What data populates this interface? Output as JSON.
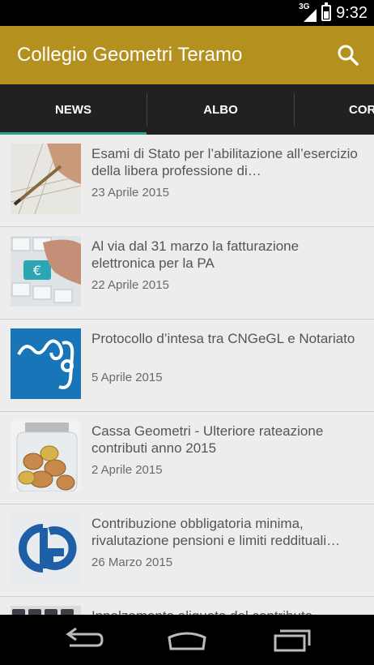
{
  "status_bar": {
    "network": "3G",
    "time": "9:32"
  },
  "action_bar": {
    "title": "Collegio Geometri Teramo",
    "search_icon": "search-icon"
  },
  "tabs": [
    {
      "label": "NEWS",
      "selected": true
    },
    {
      "label": "ALBO",
      "selected": false
    },
    {
      "label": "COR",
      "selected": false
    }
  ],
  "colors": {
    "action_bar": "#b4901e",
    "tab_bg": "#212121",
    "tab_indicator": "#2a9d94",
    "list_bg": "#ededed"
  },
  "news": [
    {
      "title": "Esami di Stato per l’abilitazione all’esercizio della libera professione di…",
      "date": "23 Aprile 2015",
      "thumb": "drafting-pencil"
    },
    {
      "title": "Al via dal 31 marzo la fatturazione elettronica per la PA",
      "date": "22 Aprile 2015",
      "thumb": "euro-key"
    },
    {
      "title": "Protocollo d’intesa tra CNGeGL e Notariato",
      "date": "5 Aprile 2015",
      "thumb": "cng-logo"
    },
    {
      "title": "Cassa Geometri - Ulteriore rateazione contributi anno 2015",
      "date": "2 Aprile 2015",
      "thumb": "coin-jar"
    },
    {
      "title": "Contribuzione obbligatoria minima, rivalutazione pensioni e limiti reddituali…",
      "date": "26 Marzo 2015",
      "thumb": "cipag-logo"
    },
    {
      "title": "Innalzamento aliquota del contributo",
      "date": "",
      "thumb": "calculator"
    }
  ],
  "nav_bar": {
    "back": "back-icon",
    "home": "home-icon",
    "recents": "recents-icon"
  }
}
